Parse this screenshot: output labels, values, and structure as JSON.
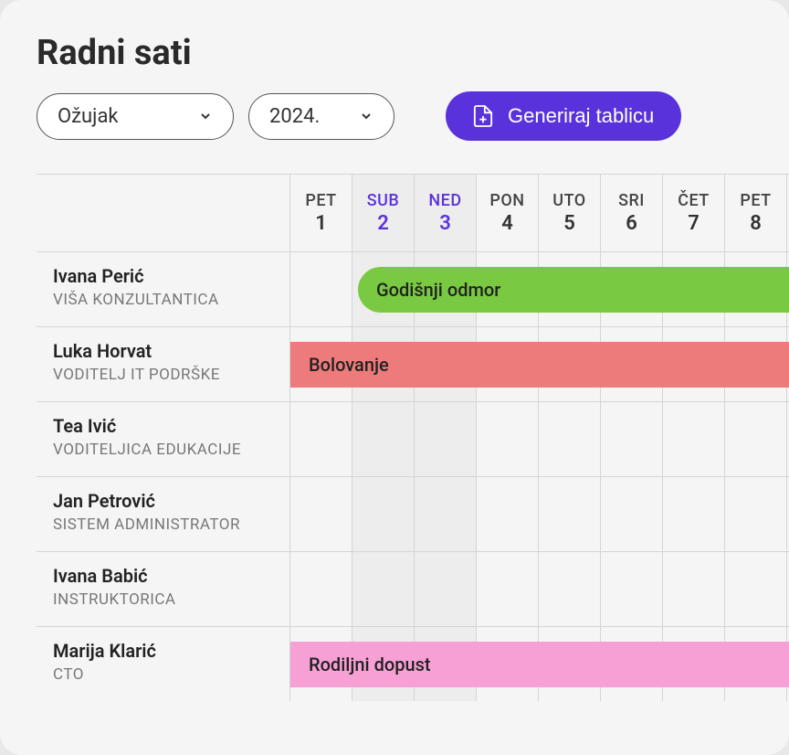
{
  "title": "Radni sati",
  "controls": {
    "month": "Ožujak",
    "year": "2024.",
    "generate_btn": "Generiraj tablicu"
  },
  "days": [
    {
      "abbr": "PET",
      "num": "1",
      "weekend": false
    },
    {
      "abbr": "SUB",
      "num": "2",
      "weekend": true
    },
    {
      "abbr": "NED",
      "num": "3",
      "weekend": true
    },
    {
      "abbr": "PON",
      "num": "4",
      "weekend": false
    },
    {
      "abbr": "UTO",
      "num": "5",
      "weekend": false
    },
    {
      "abbr": "SRI",
      "num": "6",
      "weekend": false
    },
    {
      "abbr": "ČET",
      "num": "7",
      "weekend": false
    },
    {
      "abbr": "PET",
      "num": "8",
      "weekend": false
    }
  ],
  "people": [
    {
      "name": "Ivana Perić",
      "role": "VIŠA KONZULTANTICA"
    },
    {
      "name": "Luka Horvat",
      "role": "VODITELJ IT PODRŠKE"
    },
    {
      "name": "Tea Ivić",
      "role": "VODITELJICA EDUKACIJE"
    },
    {
      "name": "Jan Petrović",
      "role": "SISTEM ADMINISTRATOR"
    },
    {
      "name": "Ivana Babić",
      "role": "INSTRUKTORICA"
    },
    {
      "name": "Marija Klarić",
      "role": "CTO"
    }
  ],
  "events": [
    {
      "row": 0,
      "start_col": 1,
      "label": "Godišnji odmor",
      "color": "green",
      "rounded_left": true
    },
    {
      "row": 1,
      "start_col": 0,
      "label": "Bolovanje",
      "color": "red",
      "rounded_left": false
    },
    {
      "row": 5,
      "start_col": 0,
      "label": "Rodiljni dopust",
      "color": "pink",
      "rounded_left": false
    }
  ],
  "colors": {
    "primary": "#5a32dc",
    "event_green": "#7ac943",
    "event_red": "#ee7b7b",
    "event_pink": "#f7a0d5"
  }
}
